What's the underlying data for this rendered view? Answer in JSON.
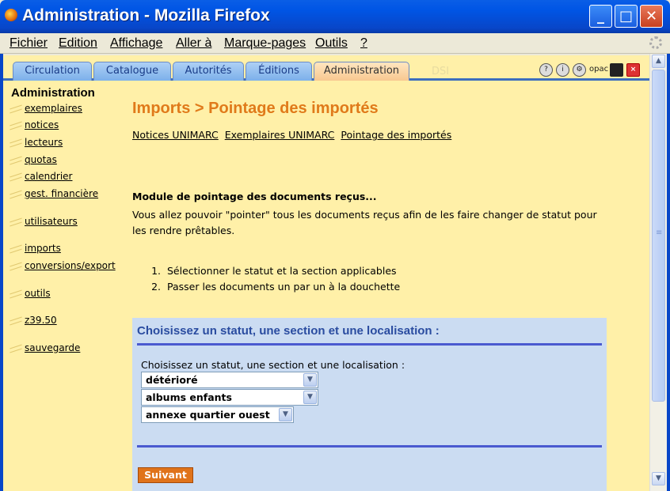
{
  "window": {
    "title": "Administration - Mozilla Firefox"
  },
  "menubar": [
    "Fichier",
    "Edition",
    "Affichage",
    "Aller à",
    "Marque-pages",
    "Outils",
    "?"
  ],
  "tabs": {
    "items": [
      "Circulation",
      "Catalogue",
      "Autorités",
      "Éditions",
      "Administration"
    ],
    "active": "Administration",
    "ghost_label": "DSI"
  },
  "toolbar_icons": [
    "help-icon",
    "about-icon",
    "settings-icon",
    "opac",
    "save-icon",
    "close-icon"
  ],
  "toolbar": {
    "opac_label": "opac"
  },
  "sidebar": {
    "title": "Administration",
    "items": [
      "exemplaires",
      "notices",
      "lecteurs",
      "quotas",
      "calendrier",
      "gest. financière",
      "utilisateurs",
      "imports",
      "conversions/export",
      "outils",
      "z39.50",
      "sauvegarde"
    ]
  },
  "main": {
    "heading": "Imports > Pointage des importés",
    "sublinks": [
      "Notices UNIMARC",
      "Exemplaires UNIMARC",
      "Pointage des importés"
    ],
    "module_title": "Module de pointage des documents reçus...",
    "module_desc": "Vous allez pouvoir \"pointer\" tous les documents reçus afin de les faire changer de statut pour les rendre prêtables.",
    "steps": [
      "Sélectionner le statut et la section applicables",
      "Passer les documents un par un à la douchette"
    ]
  },
  "form": {
    "title": "Choisissez un statut, une section et une localisation :",
    "label": "Choisissez un statut, une section et une localisation :",
    "statut": "détérioré",
    "section": "albums enfants",
    "localisation": "annexe quartier ouest",
    "submit": "Suivant"
  },
  "colors": {
    "background": "#fff0a8",
    "heading": "#e07a1a",
    "form_bg": "#cbdcf2",
    "button": "#e0731a",
    "titlebar": "#0055e5"
  }
}
